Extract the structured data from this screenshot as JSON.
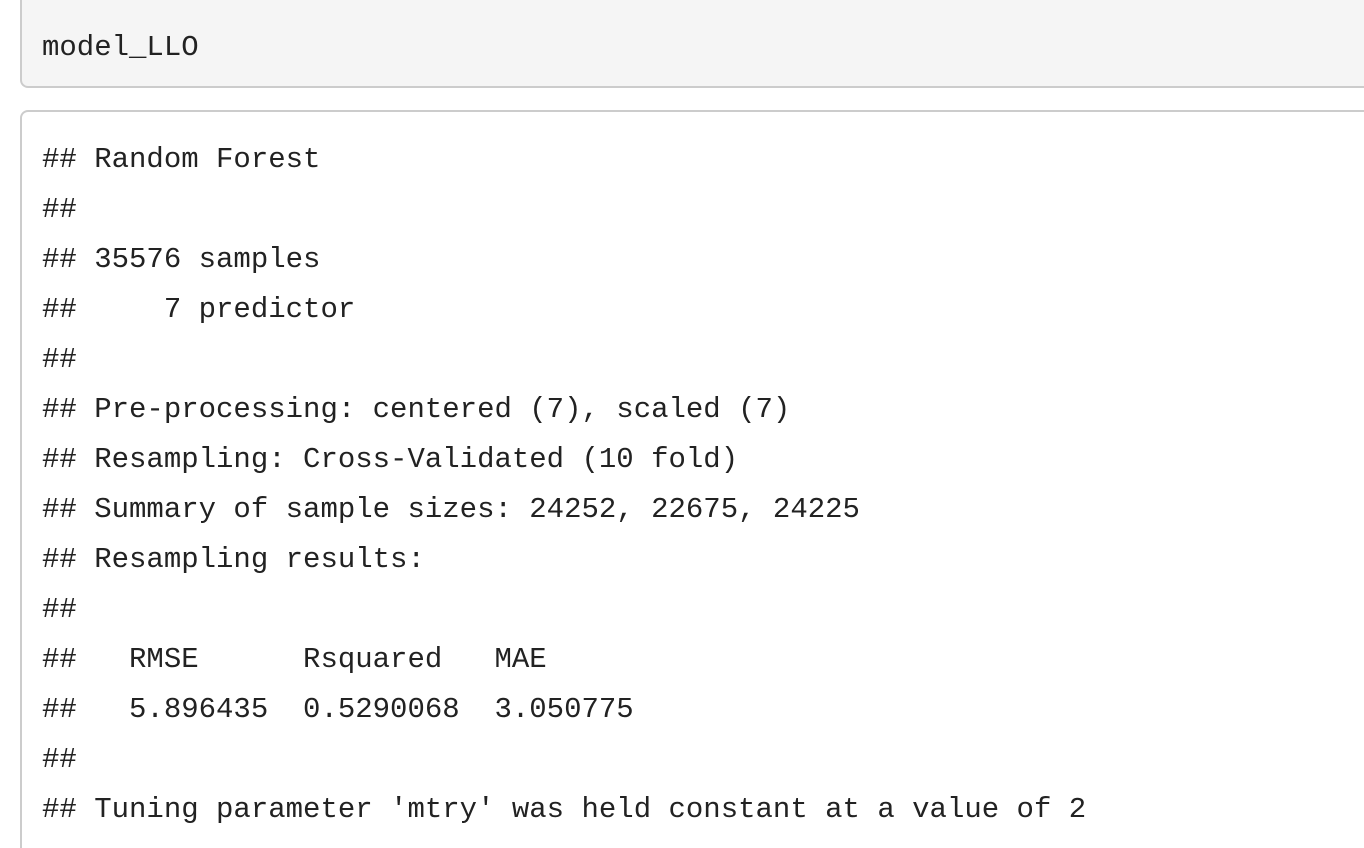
{
  "input_cell": {
    "code": "model_LLO"
  },
  "output_cell": {
    "lines": [
      "## Random Forest",
      "##",
      "## 35576 samples",
      "##     7 predictor",
      "##",
      "## Pre-processing: centered (7), scaled (7)",
      "## Resampling: Cross-Validated (10 fold)",
      "## Summary of sample sizes: 24252, 22675, 24225",
      "## Resampling results:",
      "##",
      "##   RMSE      Rsquared   MAE",
      "##   5.896435  0.5290068  3.050775",
      "##",
      "## Tuning parameter 'mtry' was held constant at a value of 2"
    ]
  }
}
